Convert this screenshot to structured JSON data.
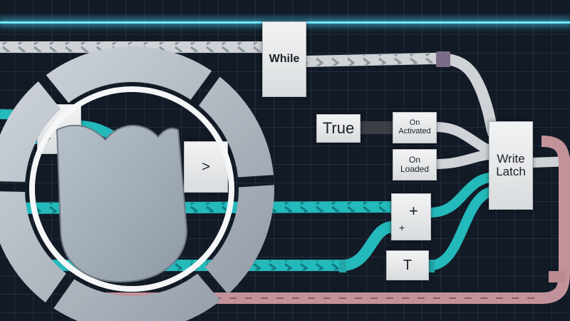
{
  "nodes": {
    "while": "While",
    "true_const": "True",
    "on_activated": "On\nActivated",
    "on_loaded": "On\nLoaded",
    "write_latch": "Write\nLatch",
    "add_top": "+",
    "add_top_port": "+",
    "tval": "T",
    "subtract": "-",
    "subtract_port": "+",
    "greater": ">"
  },
  "colors": {
    "exec_wire": "#c7ccd1",
    "number_wire": "#1fb5b7",
    "bool_wire": "#b88790",
    "node_bg": "#e6e8ea",
    "horizon_glow": "#4fe3ff"
  }
}
